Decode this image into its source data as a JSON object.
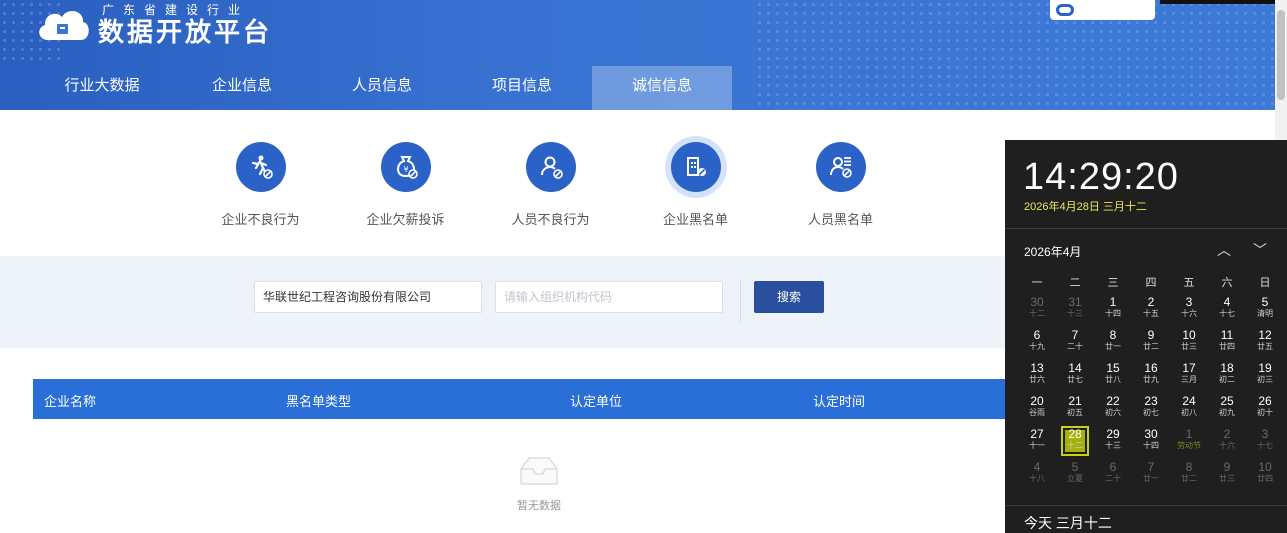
{
  "header": {
    "logo_sub": "广东省建设行业",
    "logo_main": "数据开放平台",
    "nav": [
      {
        "label": "行业大数据",
        "active": false
      },
      {
        "label": "企业信息",
        "active": false
      },
      {
        "label": "人员信息",
        "active": false
      },
      {
        "label": "项目信息",
        "active": false
      },
      {
        "label": "诚信信息",
        "active": true
      }
    ]
  },
  "categories": [
    {
      "label": "企业不良行为",
      "icon": "person-walk-icon",
      "active": false
    },
    {
      "label": "企业欠薪投诉",
      "icon": "money-bag-icon",
      "active": false
    },
    {
      "label": "人员不良行为",
      "icon": "person-ban-icon",
      "active": false
    },
    {
      "label": "企业黑名单",
      "icon": "building-ban-icon",
      "active": true
    },
    {
      "label": "人员黑名单",
      "icon": "person-list-icon",
      "active": false
    }
  ],
  "search": {
    "company_value": "华联世纪工程咨询股份有限公司",
    "org_code_placeholder": "请输入组织机构代码",
    "button_label": "搜索"
  },
  "table": {
    "columns": [
      "企业名称",
      "黑名单类型",
      "认定单位",
      "认定时间"
    ],
    "rows": [],
    "empty_text": "暂无数据"
  },
  "clock": {
    "time": "14:29:20",
    "date": "2026年4月28日 三月十二",
    "month_label": "2026年4月",
    "weekdays": [
      "一",
      "二",
      "三",
      "四",
      "五",
      "六",
      "日"
    ],
    "weeks": [
      [
        [
          "30",
          "十二",
          1
        ],
        [
          "31",
          "十三",
          1
        ],
        [
          "1",
          "十四",
          0
        ],
        [
          "2",
          "十五",
          0
        ],
        [
          "3",
          "十六",
          0
        ],
        [
          "4",
          "十七",
          0
        ],
        [
          "5",
          "清明",
          0
        ]
      ],
      [
        [
          "6",
          "十九",
          0
        ],
        [
          "7",
          "二十",
          0
        ],
        [
          "8",
          "廿一",
          0
        ],
        [
          "9",
          "廿二",
          0
        ],
        [
          "10",
          "廿三",
          0
        ],
        [
          "11",
          "廿四",
          0
        ],
        [
          "12",
          "廿五",
          0
        ]
      ],
      [
        [
          "13",
          "廿六",
          0
        ],
        [
          "14",
          "廿七",
          0
        ],
        [
          "15",
          "廿八",
          0
        ],
        [
          "16",
          "廿九",
          0
        ],
        [
          "17",
          "三月",
          0
        ],
        [
          "18",
          "初二",
          0
        ],
        [
          "19",
          "初三",
          0
        ]
      ],
      [
        [
          "20",
          "谷雨",
          0
        ],
        [
          "21",
          "初五",
          0
        ],
        [
          "22",
          "初六",
          0
        ],
        [
          "23",
          "初七",
          0
        ],
        [
          "24",
          "初八",
          0
        ],
        [
          "25",
          "初九",
          0
        ],
        [
          "26",
          "初十",
          0
        ]
      ],
      [
        [
          "27",
          "十一",
          0
        ],
        [
          "28",
          "十二",
          2
        ],
        [
          "29",
          "十三",
          0
        ],
        [
          "30",
          "十四",
          0
        ],
        [
          "1",
          "劳动节",
          3
        ],
        [
          "2",
          "十六",
          1
        ],
        [
          "3",
          "十七",
          1
        ]
      ],
      [
        [
          "4",
          "十八",
          1
        ],
        [
          "5",
          "立夏",
          1
        ],
        [
          "6",
          "二十",
          1
        ],
        [
          "7",
          "廿一",
          1
        ],
        [
          "8",
          "廿二",
          1
        ],
        [
          "9",
          "廿三",
          1
        ],
        [
          "10",
          "廿四",
          1
        ]
      ]
    ],
    "today_label": "今天 三月十二"
  },
  "colors": {
    "primary": "#2a62c8",
    "table_header": "#2a6fd8",
    "calendar_today": "#c7d11b"
  }
}
